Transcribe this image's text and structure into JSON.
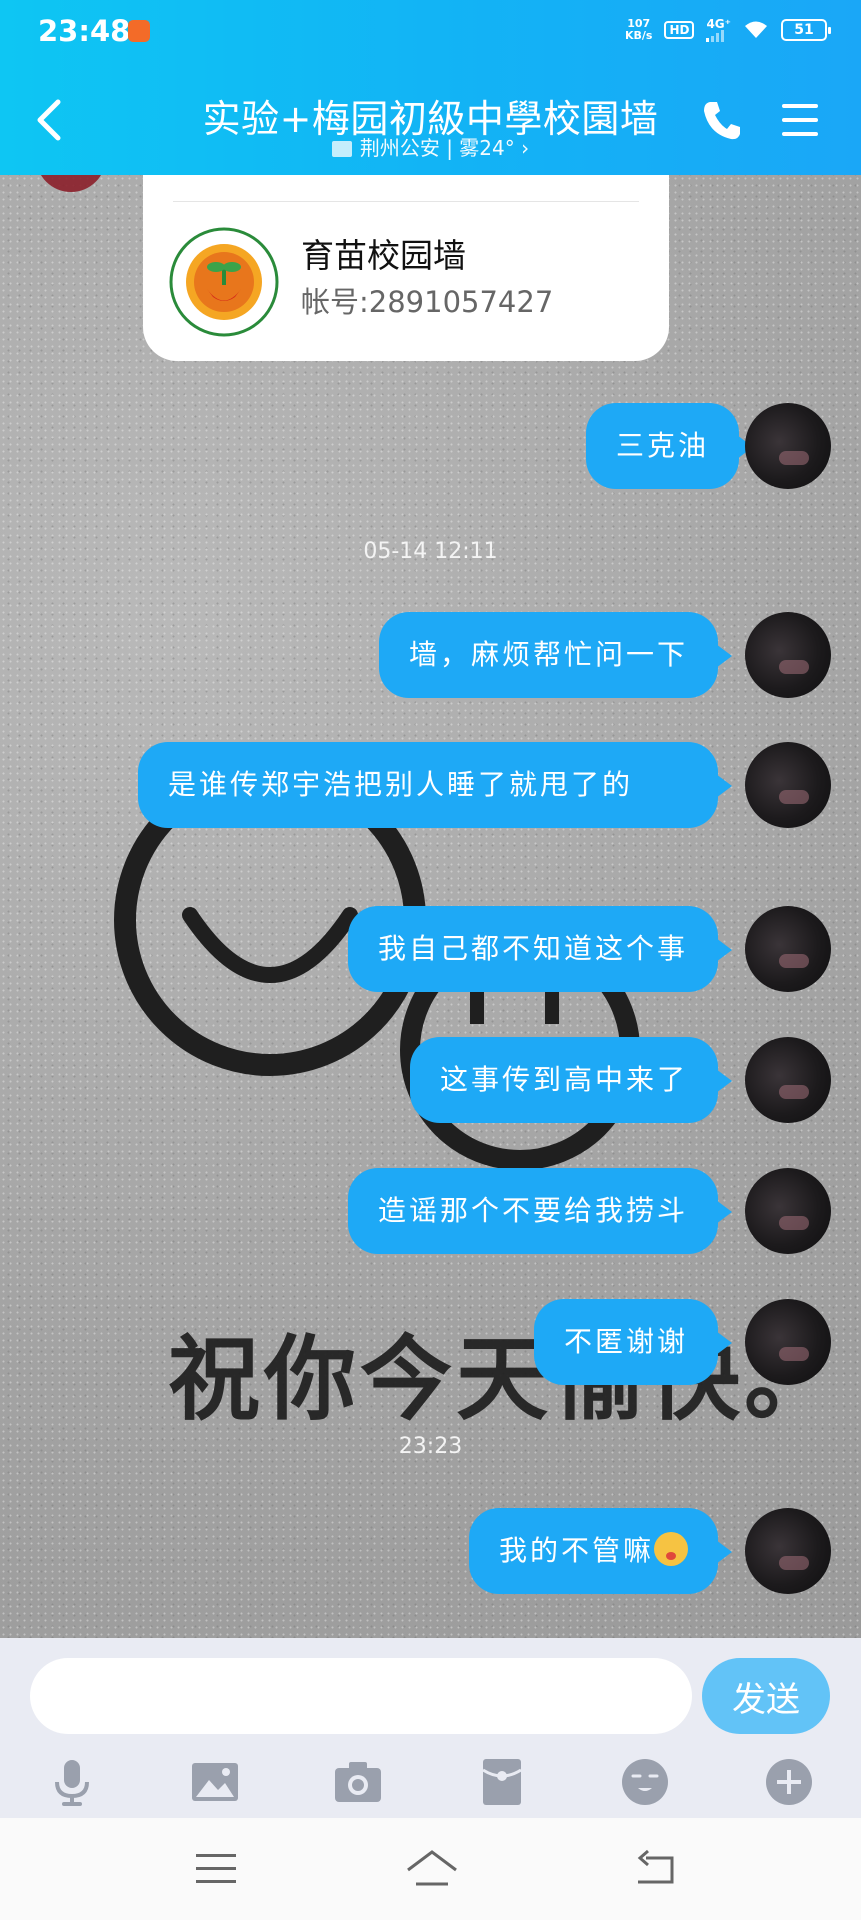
{
  "status_bar": {
    "time": "23:48",
    "net_speed_value": "107",
    "net_speed_unit": "KB/s",
    "hd_badge": "HD",
    "network_type": "4G⁺",
    "battery": "51"
  },
  "header": {
    "title": "实验+梅园初級中學校園墙",
    "subtitle": "荆州公安 | 雾24° ›"
  },
  "contact_card": {
    "name": "育苗校园墙",
    "account": "帐号:2891057427"
  },
  "messages": [
    {
      "text": "三克油"
    },
    {
      "text": "墙，麻烦帮忙问一下"
    },
    {
      "text": "是谁传郑宇浩把别人睡了就甩了的"
    },
    {
      "text": "我自己都不知道这个事"
    },
    {
      "text": "这事传到高中来了"
    },
    {
      "text": "造谣那个不要给我捞斗"
    },
    {
      "text": "不匿谢谢"
    },
    {
      "text": "我的不管嘛"
    }
  ],
  "timestamps": [
    "05-14 12:11",
    "23:23"
  ],
  "background": {
    "slogan": "祝你今天愉快。"
  },
  "composer": {
    "input_value": "",
    "send_label": "发送"
  },
  "toolbar_icons": [
    "microphone-icon",
    "image-icon",
    "camera-icon",
    "red-packet-icon",
    "emoji-icon",
    "plus-icon"
  ],
  "colors": {
    "header_gradient_start": "#0ec6f3",
    "header_gradient_end": "#1aa7f7",
    "bubble": "#1ea9f6",
    "send_button": "#62c3f7"
  }
}
